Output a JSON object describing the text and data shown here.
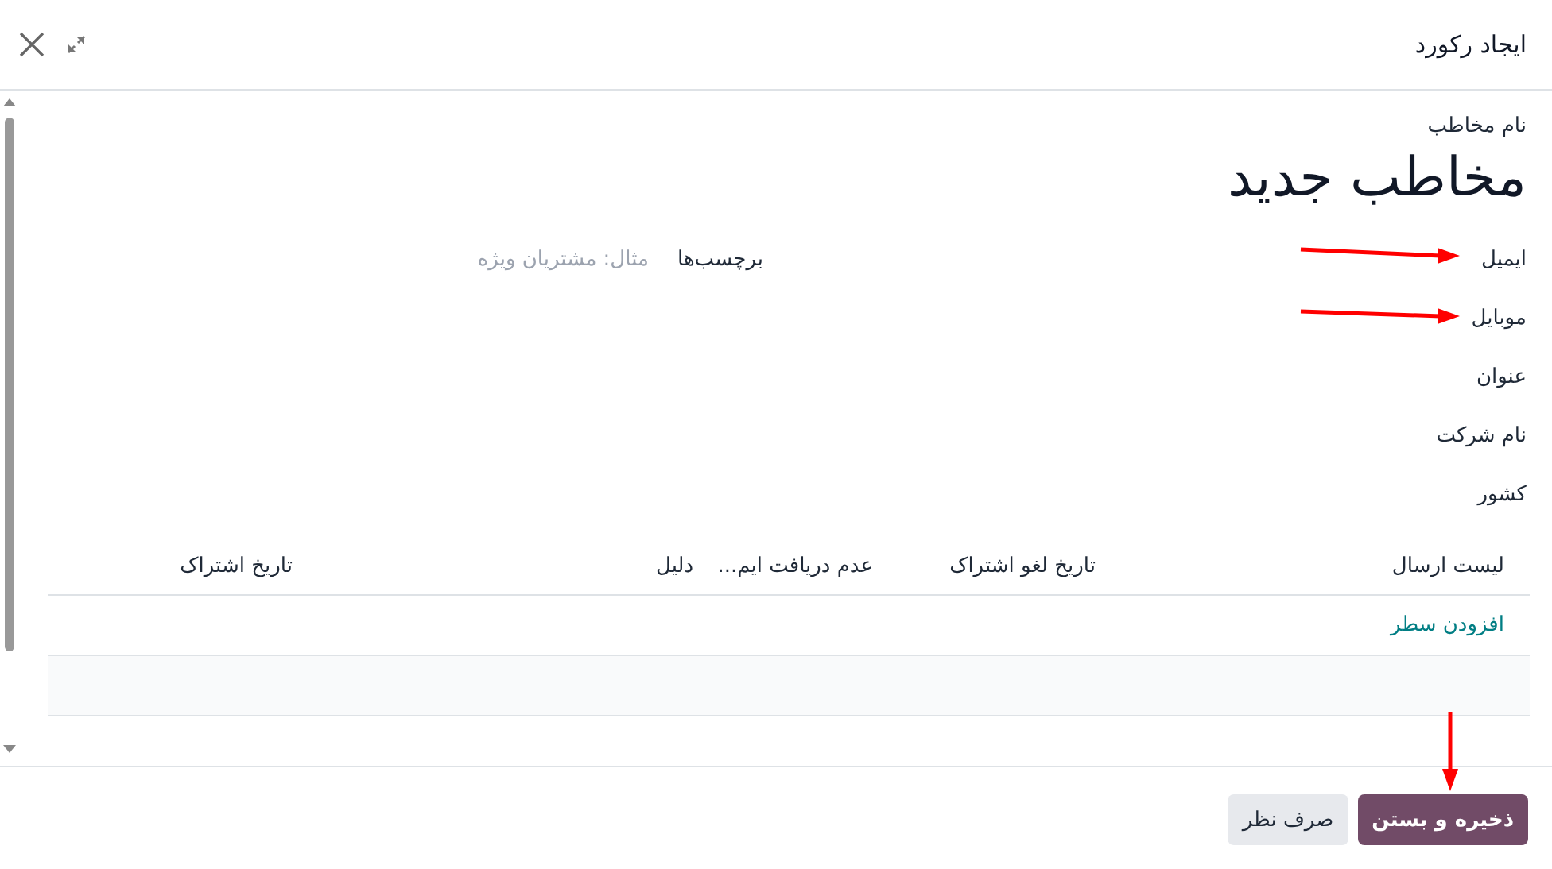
{
  "window": {
    "title": "ایجاد رکورد"
  },
  "contact_name": {
    "label": "نام مخاطب",
    "value": "مخاطب جدید"
  },
  "fields": [
    {
      "label": "ایمیل"
    },
    {
      "label": "موبایل"
    },
    {
      "label": "عنوان"
    },
    {
      "label": "نام شرکت"
    },
    {
      "label": "کشور"
    }
  ],
  "tags": {
    "label": "برچسب‌ها",
    "placeholder": "مثال: مشتریان ویژه"
  },
  "table": {
    "columns": [
      "لیست ارسال",
      "تاریخ لغو اشتراک",
      "عدم دریافت ایم...",
      "دلیل",
      "تاریخ اشتراک"
    ],
    "add_line": "افزودن سطر"
  },
  "buttons": [
    {
      "label": "ذخیره و بستن",
      "kind": "primary"
    },
    {
      "label": "صرف نظر",
      "kind": "secondary"
    }
  ]
}
